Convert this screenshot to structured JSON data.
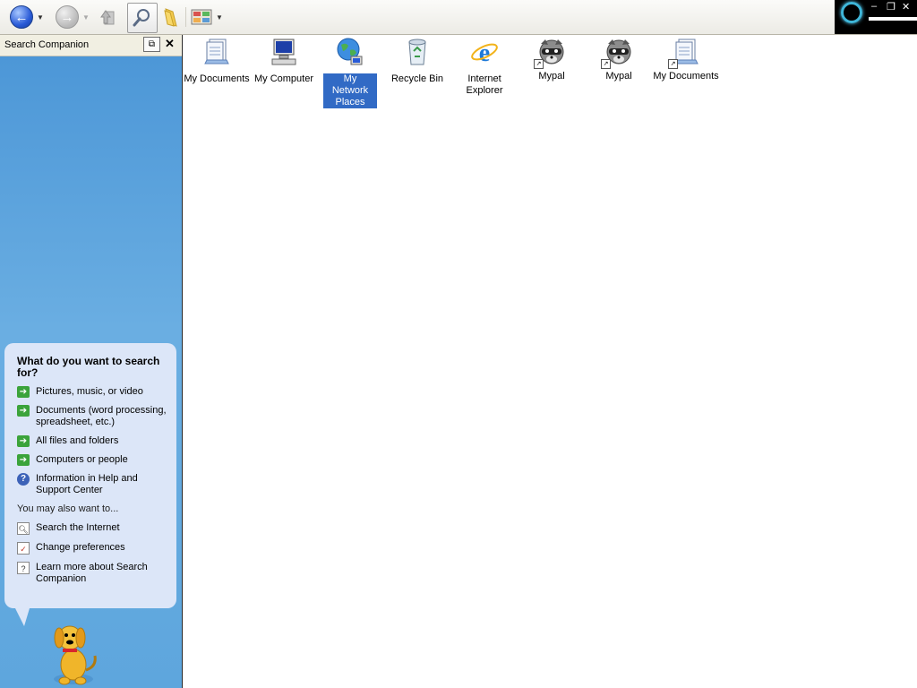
{
  "toolbar": {
    "back_icon": "back-arrow-icon",
    "forward_icon": "forward-arrow-icon",
    "up_icon": "up-folder-icon",
    "search_icon": "search-magnifier-icon",
    "folders_icon": "folders-icon",
    "views_icon": "views-icon",
    "window_controls": {
      "minimize": "–",
      "restore": "❐",
      "close": "✕"
    }
  },
  "pane": {
    "title": "Search Companion",
    "pin_label": "⧉",
    "close_label": "✕",
    "question": "What do you want to search for?",
    "options": [
      {
        "label": "Pictures, music, or video",
        "icon": "green-arrow-icon"
      },
      {
        "label": "Documents (word processing, spreadsheet, etc.)",
        "icon": "green-arrow-icon"
      },
      {
        "label": "All files and folders",
        "icon": "green-arrow-icon"
      },
      {
        "label": "Computers or people",
        "icon": "green-arrow-icon"
      },
      {
        "label": "Information in Help and Support Center",
        "icon": "help-icon"
      }
    ],
    "also_heading": "You may also want to...",
    "also_links": [
      {
        "label": "Search the Internet",
        "icon": "internet-search-icon"
      },
      {
        "label": "Change preferences",
        "icon": "preferences-icon"
      },
      {
        "label": "Learn more about Search Companion",
        "icon": "help-question-icon"
      }
    ],
    "character": "search-dog-icon"
  },
  "desktop": {
    "icons": [
      {
        "label": "My Documents",
        "icon": "documents-icon",
        "shortcut": false,
        "selected": false
      },
      {
        "label": "My Computer",
        "icon": "computer-icon",
        "shortcut": false,
        "selected": false
      },
      {
        "label": "My Network Places",
        "icon": "network-globe-icon",
        "shortcut": false,
        "selected": true
      },
      {
        "label": "Recycle Bin",
        "icon": "recycle-bin-icon",
        "shortcut": false,
        "selected": false
      },
      {
        "label": "Internet Explorer",
        "icon": "internet-explorer-icon",
        "shortcut": false,
        "selected": false
      },
      {
        "label": "Mypal",
        "icon": "mypal-raccoon-icon",
        "shortcut": true,
        "selected": false
      },
      {
        "label": "Mypal",
        "icon": "mypal-raccoon-icon",
        "shortcut": true,
        "selected": false
      },
      {
        "label": "My Documents",
        "icon": "documents-icon",
        "shortcut": true,
        "selected": false
      }
    ],
    "selection_color": "#316ac5"
  }
}
